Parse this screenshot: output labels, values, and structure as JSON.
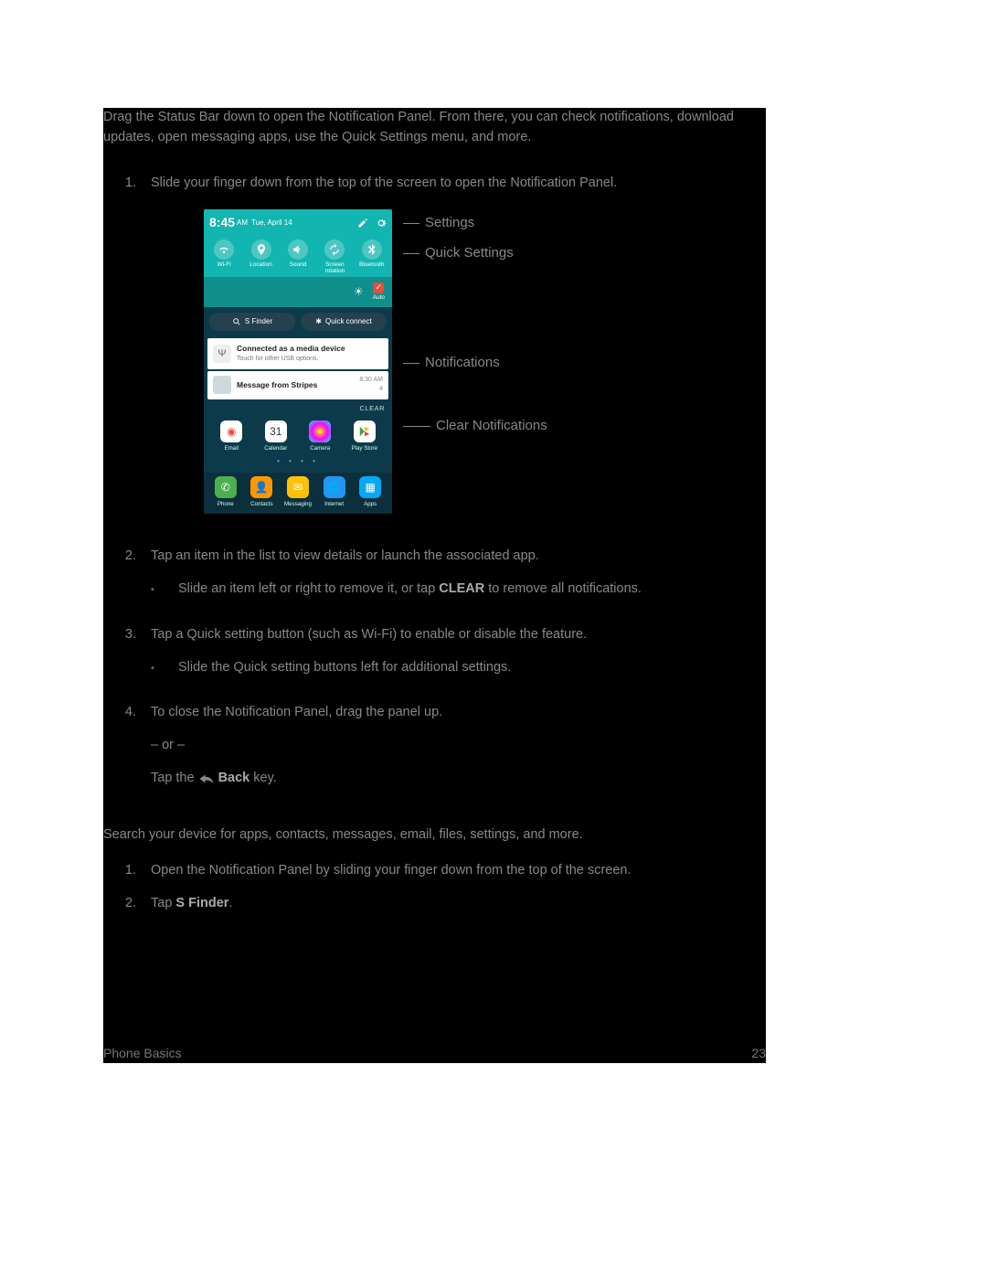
{
  "intro": "Drag the Status Bar down to open the Notification Panel. From there, you can check notifications, download updates, open messaging apps, use the Quick Settings menu, and more.",
  "steps": {
    "s1": "Slide your finger down from the top of the screen to open the Notification Panel.",
    "s2": "Tap an item in the list to view details or launch the associated app.",
    "s2_sub_pre": "Slide an item left or right to remove it, or tap ",
    "s2_sub_bold": "CLEAR",
    "s2_sub_post": " to remove all notifications.",
    "s3": "Tap a Quick setting button (such as Wi-Fi) to enable or disable the feature.",
    "s3_sub": "Slide the Quick setting buttons left for additional settings.",
    "s4": "To close the Notification Panel, drag the panel up.",
    "s4_or": "– or –",
    "s4_tap_pre": "Tap the ",
    "s4_tap_bold": " Back",
    "s4_tap_post": " key."
  },
  "section2_intro": "Search your device for apps, contacts, messages, email, files, settings, and more.",
  "sfinder": {
    "s1": "Open the Notification Panel by sliding your finger down from the top of the screen.",
    "s2_pre": "Tap ",
    "s2_bold": "S Finder",
    "s2_post": "."
  },
  "footer": {
    "left": "Phone Basics",
    "right": "23"
  },
  "callouts": {
    "settings": "Settings",
    "quick": "Quick Settings",
    "notifs": "Notifications",
    "clear": "Clear Notifications"
  },
  "phone": {
    "time": "8:45",
    "ampm": "AM",
    "date": "Tue, April 14",
    "qs": {
      "wifi": "Wi-Fi",
      "location": "Location",
      "sound": "Sound",
      "rotation": "Screen rotation",
      "bluetooth": "Bluetooth"
    },
    "auto": "Auto",
    "sfinder": "S Finder",
    "quickconnect": "Quick connect",
    "n1_title": "Connected as a media device",
    "n1_sub": "Touch for other USB options.",
    "n2_title": "Message from Stripes",
    "n2_time": "8:30 AM",
    "n2_count": "4",
    "clear": "CLEAR",
    "apps_row1": {
      "email": "Email",
      "calendar": "Calendar",
      "camera": "Camera",
      "playstore": "Play Store"
    },
    "cal_num": "31",
    "dock": {
      "phone": "Phone",
      "contacts": "Contacts",
      "messaging": "Messaging",
      "internet": "Internet",
      "apps": "Apps"
    }
  }
}
